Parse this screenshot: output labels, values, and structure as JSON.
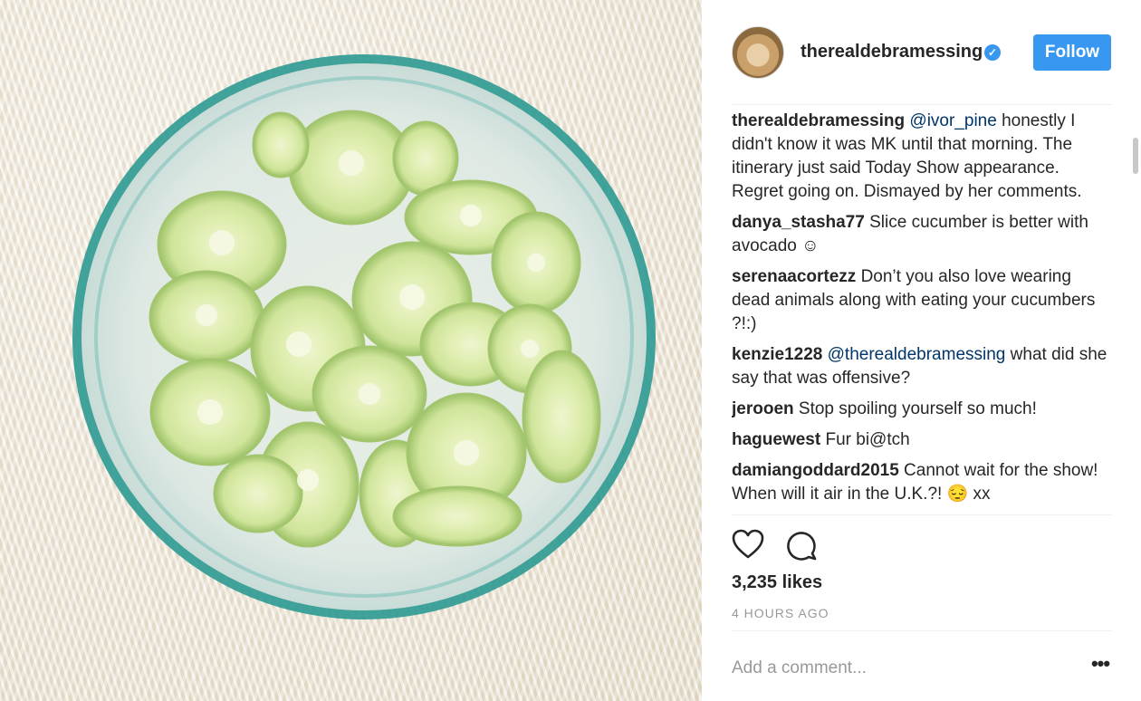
{
  "post": {
    "username": "therealdebramessing",
    "follow_label": "Follow",
    "verified_icon": "verified-badge-icon",
    "likes": "3,235 likes",
    "time": "4 HOURS AGO",
    "add_comment_placeholder": "Add a comment...",
    "more_options": "•••"
  },
  "comments": [
    {
      "user": "therealdebramessing",
      "mention": "@ivor_pine",
      "text": " honestly I didn't know it was MK until that morning. The itinerary just said Today Show appearance. Regret going on. Dismayed by her comments."
    },
    {
      "user": "danya_stasha77",
      "mention": "",
      "text": " Slice cucumber is better with avocado ☺"
    },
    {
      "user": "serenaacortezz",
      "mention": "",
      "text": " Don’t you also love wearing dead animals along with eating your cucumbers ?!:)"
    },
    {
      "user": "kenzie1228",
      "mention": "@therealdebramessing",
      "text": " what did she say that was offensive?"
    },
    {
      "user": "jerooen",
      "mention": "",
      "text": " Stop spoiling yourself so much!"
    },
    {
      "user": "haguewest",
      "mention": "",
      "text": " Fur bi@tch"
    },
    {
      "user": "damiangoddard2015",
      "mention": "",
      "text": " Cannot wait for the show! When will it air in the U.K.?! 😔 xx"
    }
  ],
  "colors": {
    "accent": "#3897f0",
    "mention": "#003569",
    "muted": "#999999"
  },
  "icons": {
    "like": "heart-icon",
    "comment": "comment-bubble-icon",
    "more": "more-options-icon"
  }
}
